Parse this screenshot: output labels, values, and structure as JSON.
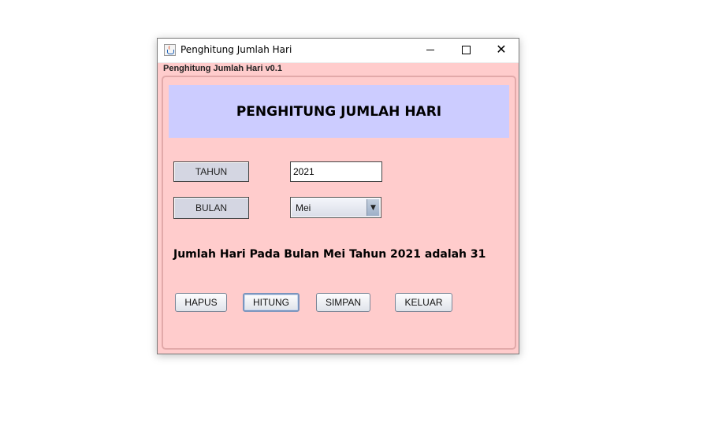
{
  "window": {
    "title": "Penghitung Jumlah Hari",
    "frame_label": "Penghitung Jumlah Hari v0.1",
    "controls": {
      "minimize_icon": "minimize-icon",
      "maximize_icon": "maximize-icon",
      "close_icon": "close-icon",
      "close_glyph": "✕"
    }
  },
  "header": {
    "title": "PENGHITUNG JUMLAH HARI",
    "background": "#ccccff"
  },
  "form": {
    "tahun_label": "TAHUN",
    "tahun_value": "2021",
    "bulan_label": "BULAN",
    "bulan_selected": "Mei",
    "dropdown_arrow": "▼"
  },
  "result_text": "Jumlah Hari Pada Bulan Mei Tahun 2021 adalah 31",
  "buttons": {
    "hapus": "HAPUS",
    "hitung": "HITUNG",
    "simpan": "SIMPAN",
    "keluar": "KELUAR"
  },
  "colors": {
    "window_background": "#ffcccc",
    "header_background": "#ccccff"
  }
}
